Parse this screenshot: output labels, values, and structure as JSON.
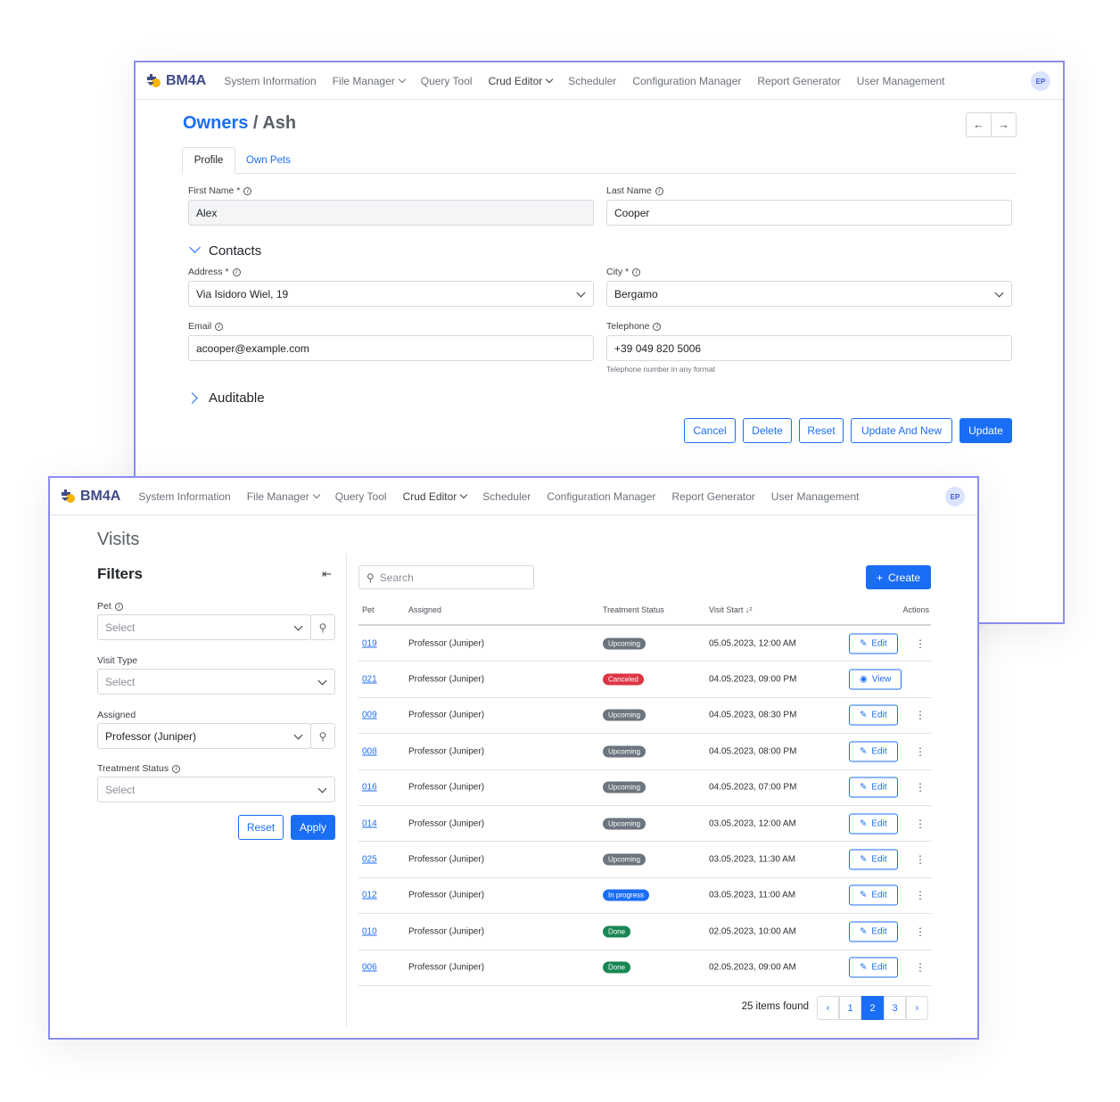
{
  "nav": {
    "brand": "BM4A",
    "items": [
      "System Information",
      "File Manager",
      "Query Tool",
      "Crud Editor",
      "Scheduler",
      "Configuration Manager",
      "Report Generator",
      "User Management"
    ],
    "avatar": "EP"
  },
  "owner_form": {
    "breadcrumb_root": "Owners",
    "breadcrumb_sep": "/",
    "breadcrumb_current": "Ash",
    "tabs": [
      "Profile",
      "Own Pets"
    ],
    "first_name": {
      "label": "First Name *",
      "value": "Alex"
    },
    "last_name": {
      "label": "Last Name",
      "value": "Cooper"
    },
    "contacts_title": "Contacts",
    "address": {
      "label": "Address *",
      "value": "Via Isidoro Wiel, 19"
    },
    "city": {
      "label": "City *",
      "value": "Bergamo"
    },
    "email": {
      "label": "Email",
      "value": "acooper@example.com"
    },
    "telephone": {
      "label": "Telephone",
      "value": "+39 049 820 5006",
      "help": "Telephone number in any format"
    },
    "auditable_title": "Auditable",
    "buttons": {
      "cancel": "Cancel",
      "delete": "Delete",
      "reset": "Reset",
      "update_new": "Update And New",
      "update": "Update"
    }
  },
  "visits": {
    "title": "Visits",
    "filters": {
      "title": "Filters",
      "pet_label": "Pet",
      "pet_value": "Select",
      "visit_type_label": "Visit Type",
      "visit_type_value": "Select",
      "assigned_label": "Assigned",
      "assigned_value": "Professor (Juniper)",
      "status_label": "Treatment Status",
      "status_value": "Select",
      "reset": "Reset",
      "apply": "Apply"
    },
    "search_placeholder": "Search",
    "create": "Create",
    "columns": [
      "Pet",
      "Assigned",
      "Treatment Status",
      "Visit Start",
      "Actions"
    ],
    "status_colors": {
      "Upcoming": "#6c757d",
      "Canceled": "#dc3545",
      "In progress": "#1a6ef5",
      "Done": "#198754"
    },
    "rows": [
      {
        "pet": "019",
        "assigned": "Professor (Juniper)",
        "status": "Upcoming",
        "start": "05.05.2023, 12:00 AM",
        "action": "Edit"
      },
      {
        "pet": "021",
        "assigned": "Professor (Juniper)",
        "status": "Canceled",
        "start": "04.05.2023, 09:00 PM",
        "action": "View"
      },
      {
        "pet": "009",
        "assigned": "Professor (Juniper)",
        "status": "Upcoming",
        "start": "04.05.2023, 08:30 PM",
        "action": "Edit"
      },
      {
        "pet": "008",
        "assigned": "Professor (Juniper)",
        "status": "Upcoming",
        "start": "04.05.2023, 08:00 PM",
        "action": "Edit"
      },
      {
        "pet": "016",
        "assigned": "Professor (Juniper)",
        "status": "Upcoming",
        "start": "04.05.2023, 07:00 PM",
        "action": "Edit"
      },
      {
        "pet": "014",
        "assigned": "Professor (Juniper)",
        "status": "Upcoming",
        "start": "03.05.2023, 12:00 AM",
        "action": "Edit"
      },
      {
        "pet": "025",
        "assigned": "Professor (Juniper)",
        "status": "Upcoming",
        "start": "03.05.2023, 11:30 AM",
        "action": "Edit"
      },
      {
        "pet": "012",
        "assigned": "Professor (Juniper)",
        "status": "In progress",
        "start": "03.05.2023, 11:00 AM",
        "action": "Edit"
      },
      {
        "pet": "010",
        "assigned": "Professor (Juniper)",
        "status": "Done",
        "start": "02.05.2023, 10:00 AM",
        "action": "Edit"
      },
      {
        "pet": "006",
        "assigned": "Professor (Juniper)",
        "status": "Done",
        "start": "02.05.2023, 09:00 AM",
        "action": "Edit"
      }
    ],
    "items_found": "25 items found",
    "pages": [
      "1",
      "2",
      "3"
    ],
    "current_page": "2"
  }
}
